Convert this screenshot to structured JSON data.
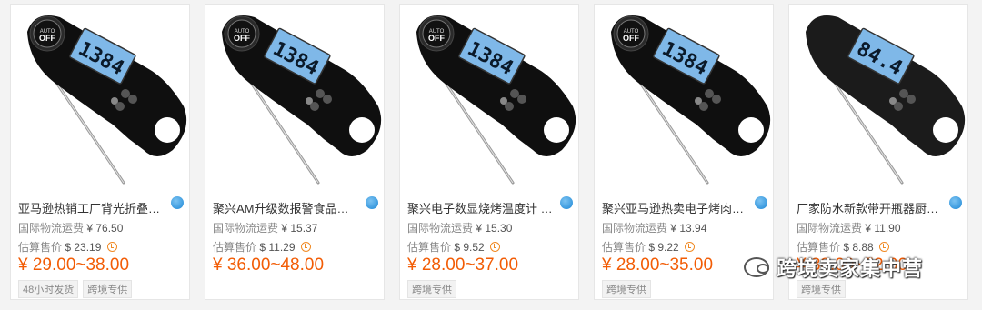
{
  "products": [
    {
      "title": "亚马逊热销工厂背光折叠探针B...",
      "shipping_label": "国际物流运费",
      "shipping_value": "¥ 76.50",
      "est_label": "估算售价",
      "est_value": "$ 23.19",
      "price": "¥ 29.00~38.00",
      "display": "1384",
      "tags": [
        "48小时发货",
        "跨境专供"
      ],
      "style": "gloss"
    },
    {
      "title": "聚兴AM升级数报警食品烤肉温...",
      "shipping_label": "国际物流运费",
      "shipping_value": "¥ 15.37",
      "est_label": "估算售价",
      "est_value": "$ 11.29",
      "price": "¥ 36.00~48.00",
      "display": "1384",
      "tags": [],
      "style": "gloss"
    },
    {
      "title": "聚兴电子数显烧烤温度计 背光...",
      "shipping_label": "国际物流运费",
      "shipping_value": "¥ 15.30",
      "est_label": "估算售价",
      "est_value": "$ 9.52",
      "price": "¥ 28.00~37.00",
      "display": "1384",
      "tags": [
        "跨境专供"
      ],
      "style": "gloss"
    },
    {
      "title": "聚兴亚马逊热卖电子烤肉厨房...",
      "shipping_label": "国际物流运费",
      "shipping_value": "¥ 13.94",
      "est_label": "估算售价",
      "est_value": "$ 9.22",
      "price": "¥ 28.00~35.00",
      "display": "1384",
      "tags": [
        "跨境专供"
      ],
      "style": "gloss"
    },
    {
      "title": "厂家防水新款带开瓶器厨房食...",
      "shipping_label": "国际物流运费",
      "shipping_value": "¥ 11.90",
      "est_label": "估算售价",
      "est_value": "$ 8.88",
      "price": "¥ 38.00~52.00",
      "display": "84.4",
      "tags": [
        "跨境专供"
      ],
      "style": "plain"
    }
  ],
  "watermark": "跨境卖家集中营",
  "icons": {
    "location": "globe-icon",
    "estimate": "clock-icon",
    "watermark": "wechat-icon"
  },
  "colors": {
    "price": "#f25c05",
    "clock": "#f08a24"
  }
}
